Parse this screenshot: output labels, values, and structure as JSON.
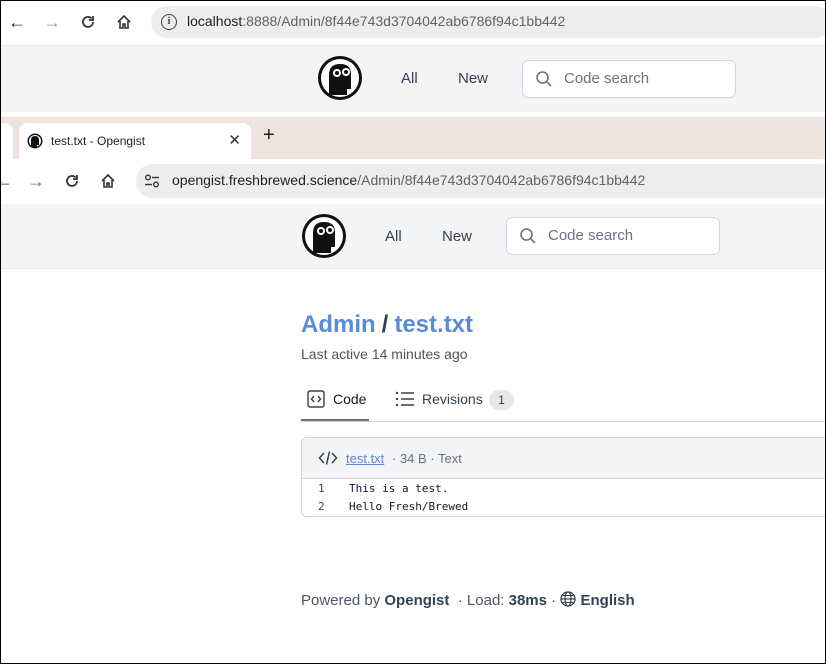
{
  "browser1": {
    "url_host": "localhost",
    "url_rest": ":8888/Admin/8f44e743d3704042ab6786f94c1bb442"
  },
  "browser2": {
    "tab_title": "test.txt - Opengist",
    "url_host": "opengist.freshbrewed.science",
    "url_rest": "/Admin/8f44e743d3704042ab6786f94c1bb442"
  },
  "nav": {
    "all": "All",
    "new": "New",
    "search_placeholder": "Code search"
  },
  "gist": {
    "owner": "Admin",
    "separator": "/",
    "name": "test.txt",
    "last_active": "Last active 14 minutes ago"
  },
  "tabs": {
    "code": "Code",
    "revisions": "Revisions",
    "revisions_count": "1"
  },
  "file": {
    "name": "test.txt",
    "meta": "· 34 B · Text",
    "lines": [
      {
        "num": "1",
        "text": "This is a test."
      },
      {
        "num": "2",
        "text": "Hello Fresh/Brewed"
      }
    ]
  },
  "footer": {
    "powered_by": "Powered by",
    "brand": "Opengist",
    "load_label": "· Load:",
    "load_value": "38ms",
    "dot": "·",
    "language": "English"
  }
}
